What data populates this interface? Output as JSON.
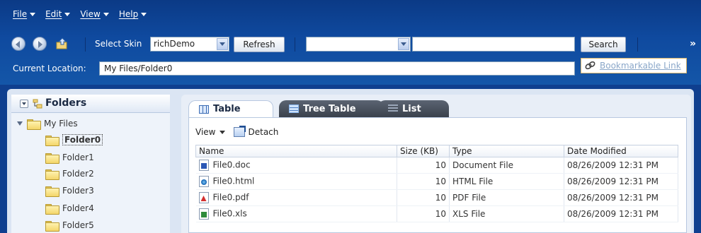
{
  "menubar": [
    "File",
    "Edit",
    "View",
    "Help"
  ],
  "toolbar": {
    "select_skin_label": "Select Skin",
    "skin_value": "richDemo",
    "refresh_label": "Refresh",
    "search_label": "Search",
    "chevron": "»"
  },
  "location": {
    "label": "Current Location:",
    "value": "My Files/Folder0",
    "bookmark_link": "Bookmarkable Link"
  },
  "folders": {
    "title": "Folders",
    "root": "My Files",
    "items": [
      "Folder0",
      "Folder1",
      "Folder2",
      "Folder3",
      "Folder4",
      "Folder5"
    ]
  },
  "tabs": [
    "Table",
    "Tree Table",
    "List"
  ],
  "subtoolbar": {
    "view": "View",
    "detach": "Detach"
  },
  "table": {
    "headers": [
      "Name",
      "Size (KB)",
      "Type",
      "Date Modified"
    ],
    "rows": [
      {
        "name": "File0.doc",
        "size": "10",
        "type": "Document File",
        "date": "08/26/2009 12:31 PM",
        "icon": "word-icon"
      },
      {
        "name": "File0.html",
        "size": "10",
        "type": "HTML File",
        "date": "08/26/2009 12:31 PM",
        "icon": "html-icon"
      },
      {
        "name": "File0.pdf",
        "size": "10",
        "type": "PDF File",
        "date": "08/26/2009 12:31 PM",
        "icon": "pdf-icon"
      },
      {
        "name": "File0.xls",
        "size": "10",
        "type": "XLS File",
        "date": "08/26/2009 12:31 PM",
        "icon": "excel-icon"
      }
    ]
  }
}
